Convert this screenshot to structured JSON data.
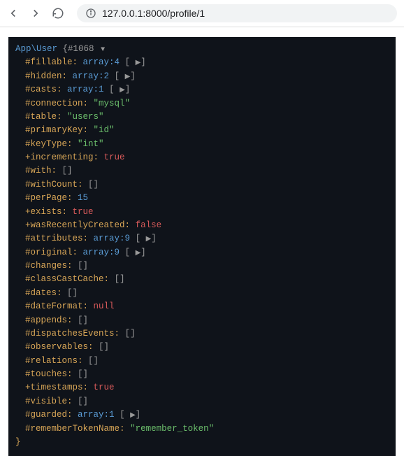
{
  "browser": {
    "url": "127.0.0.1:8000/profile/1"
  },
  "dump": {
    "class_name": "App\\User",
    "object_id": "#1068",
    "open_brace": "{",
    "close_brace": "}",
    "toggle_glyph": "▼",
    "expand_glyph": "▶",
    "props": [
      {
        "vis": "#",
        "name": "fillable",
        "kind": "array",
        "count": 4,
        "expandable": true
      },
      {
        "vis": "#",
        "name": "hidden",
        "kind": "array",
        "count": 2,
        "expandable": true
      },
      {
        "vis": "#",
        "name": "casts",
        "kind": "array",
        "count": 1,
        "expandable": true
      },
      {
        "vis": "#",
        "name": "connection",
        "kind": "string",
        "value": "\"mysql\""
      },
      {
        "vis": "#",
        "name": "table",
        "kind": "string",
        "value": "\"users\""
      },
      {
        "vis": "#",
        "name": "primaryKey",
        "kind": "string",
        "value": "\"id\""
      },
      {
        "vis": "#",
        "name": "keyType",
        "kind": "string",
        "value": "\"int\""
      },
      {
        "vis": "+",
        "name": "incrementing",
        "kind": "bool",
        "value": "true"
      },
      {
        "vis": "#",
        "name": "with",
        "kind": "empty_array",
        "value": "[]"
      },
      {
        "vis": "#",
        "name": "withCount",
        "kind": "empty_array",
        "value": "[]"
      },
      {
        "vis": "#",
        "name": "perPage",
        "kind": "int",
        "value": "15"
      },
      {
        "vis": "+",
        "name": "exists",
        "kind": "bool",
        "value": "true"
      },
      {
        "vis": "+",
        "name": "wasRecentlyCreated",
        "kind": "bool",
        "value": "false"
      },
      {
        "vis": "#",
        "name": "attributes",
        "kind": "array",
        "count": 9,
        "expandable": true
      },
      {
        "vis": "#",
        "name": "original",
        "kind": "array",
        "count": 9,
        "expandable": true
      },
      {
        "vis": "#",
        "name": "changes",
        "kind": "empty_array",
        "value": "[]"
      },
      {
        "vis": "#",
        "name": "classCastCache",
        "kind": "empty_array",
        "value": "[]"
      },
      {
        "vis": "#",
        "name": "dates",
        "kind": "empty_array",
        "value": "[]"
      },
      {
        "vis": "#",
        "name": "dateFormat",
        "kind": "null",
        "value": "null"
      },
      {
        "vis": "#",
        "name": "appends",
        "kind": "empty_array",
        "value": "[]"
      },
      {
        "vis": "#",
        "name": "dispatchesEvents",
        "kind": "empty_array",
        "value": "[]"
      },
      {
        "vis": "#",
        "name": "observables",
        "kind": "empty_array",
        "value": "[]"
      },
      {
        "vis": "#",
        "name": "relations",
        "kind": "empty_array",
        "value": "[]"
      },
      {
        "vis": "#",
        "name": "touches",
        "kind": "empty_array",
        "value": "[]"
      },
      {
        "vis": "+",
        "name": "timestamps",
        "kind": "bool",
        "value": "true"
      },
      {
        "vis": "#",
        "name": "visible",
        "kind": "empty_array",
        "value": "[]"
      },
      {
        "vis": "#",
        "name": "guarded",
        "kind": "array",
        "count": 1,
        "expandable": true
      },
      {
        "vis": "#",
        "name": "rememberTokenName",
        "kind": "string",
        "value": "\"remember_token\""
      }
    ]
  }
}
